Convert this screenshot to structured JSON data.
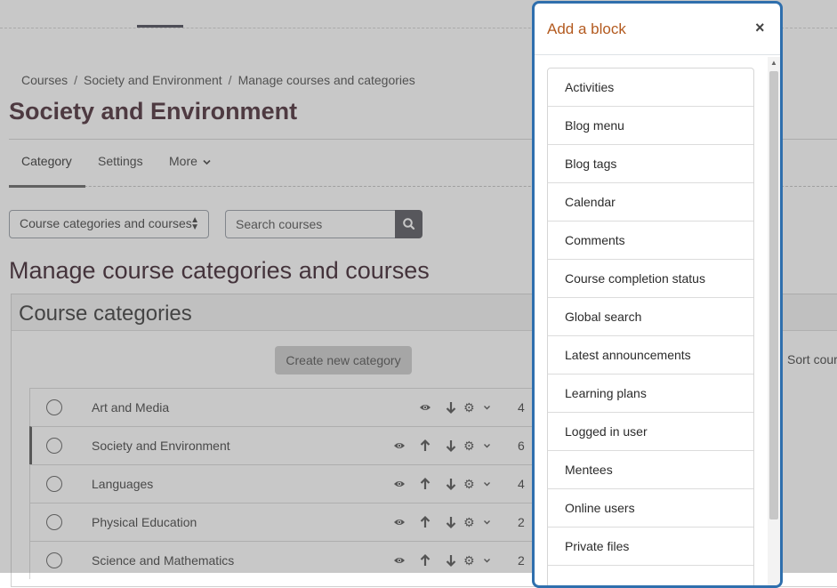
{
  "breadcrumb": [
    "Courses",
    "Society and Environment",
    "Manage courses and categories"
  ],
  "page_title": "Society and Environment",
  "secondary_nav": {
    "tabs": [
      "Category",
      "Settings",
      "More"
    ],
    "active": "Category"
  },
  "view_select": {
    "value": "Course categories and courses"
  },
  "search": {
    "placeholder": "Search courses"
  },
  "manage_title": "Manage course categories and courses",
  "categories_panel": {
    "heading": "Course categories",
    "create_button": "Create new category",
    "sort_label": "Sort cour",
    "rows": [
      {
        "name": "Art and Media",
        "count": "4"
      },
      {
        "name": "Society and Environment",
        "count": "6"
      },
      {
        "name": "Languages",
        "count": "4"
      },
      {
        "name": "Physical Education",
        "count": "2"
      },
      {
        "name": "Science and Mathematics",
        "count": "2"
      }
    ]
  },
  "modal": {
    "title": "Add a block",
    "close": "×",
    "blocks": [
      "Activities",
      "Blog menu",
      "Blog tags",
      "Calendar",
      "Comments",
      "Course completion status",
      "Global search",
      "Latest announcements",
      "Learning plans",
      "Logged in user",
      "Mentees",
      "Online users",
      "Private files"
    ]
  },
  "colors": {
    "modal_border": "#2f6fad",
    "modal_title": "#b35a1f",
    "overlay": "rgba(110,110,110,0.38)"
  }
}
